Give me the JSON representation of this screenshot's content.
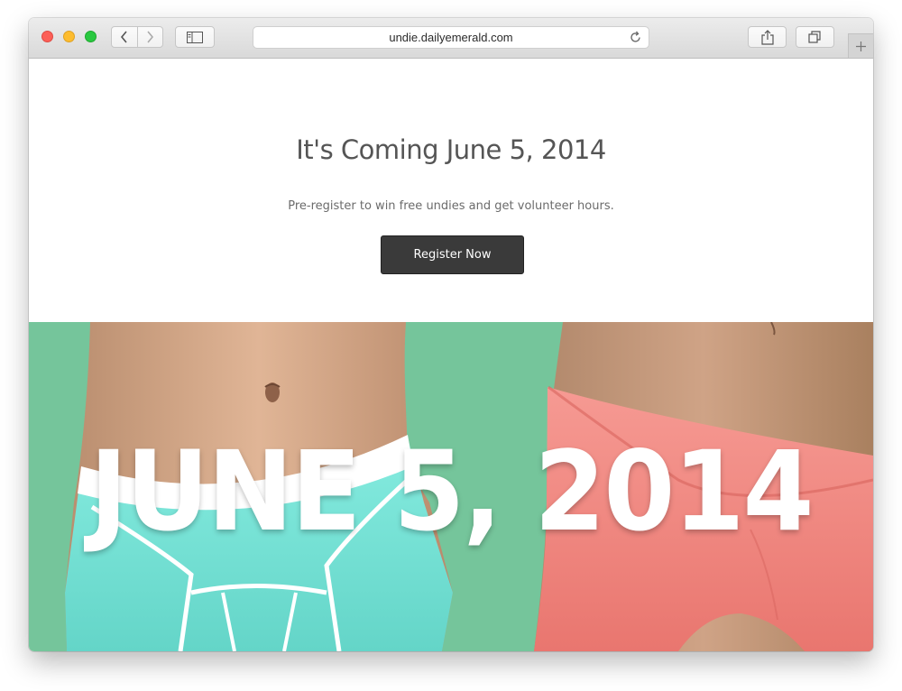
{
  "browser": {
    "url": "undie.dailyemerald.com",
    "icons": {
      "back": "chevron-left-icon",
      "forward": "chevron-right-icon",
      "sidebar": "sidebar-icon",
      "reload": "reload-icon",
      "share": "share-icon",
      "tabs": "tabs-icon",
      "new_tab": "plus-icon"
    }
  },
  "hero": {
    "title": "It's Coming June 5, 2014",
    "subtitle": "Pre-register to win free undies and get volunteer hours.",
    "register_label": "Register Now"
  },
  "banner": {
    "date_text": "JUNE 5, 2014",
    "background_color": "#75c59b"
  },
  "colors": {
    "button_bg": "#3a3a3a",
    "briefs": "#75e3d6",
    "panties": "#f2857f"
  }
}
